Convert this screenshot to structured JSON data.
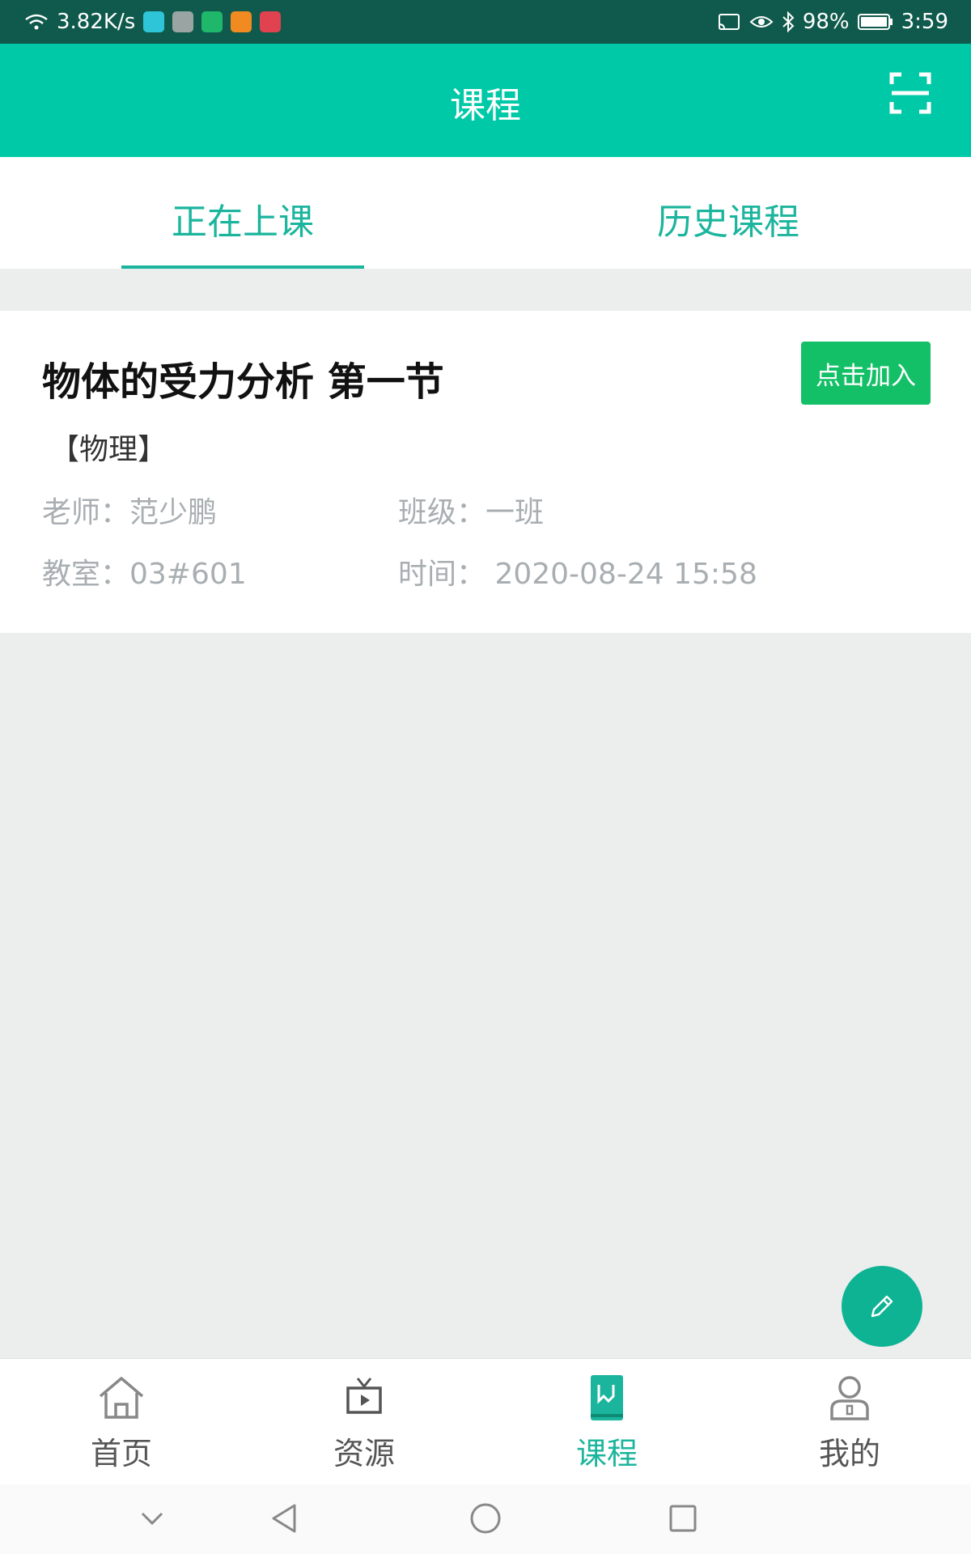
{
  "status_bar": {
    "net_speed": "3.82K/s",
    "battery": "98%",
    "time": "3:59"
  },
  "app_bar": {
    "title": "课程"
  },
  "tabs": [
    {
      "label": "正在上课"
    },
    {
      "label": "历史课程"
    }
  ],
  "course": {
    "title": "物体的受力分析 第一节",
    "join_label": "点击加入",
    "subject": "【物理】",
    "teacher": "老师：范少鹏",
    "class_name": "班级：一班",
    "room": "教室：03#601",
    "time": "时间： 2020-08-24 15:58"
  },
  "bottom_nav": [
    {
      "label": "首页",
      "icon": "home-icon"
    },
    {
      "label": "资源",
      "icon": "tv-icon"
    },
    {
      "label": "课程",
      "icon": "book-icon"
    },
    {
      "label": "我的",
      "icon": "user-icon"
    }
  ],
  "colors": {
    "primary": "#00c9a7",
    "tab_accent": "#1bb59d",
    "join_button": "#14c067",
    "status_bar": "#0f5a4c",
    "background": "#ebeeed"
  }
}
